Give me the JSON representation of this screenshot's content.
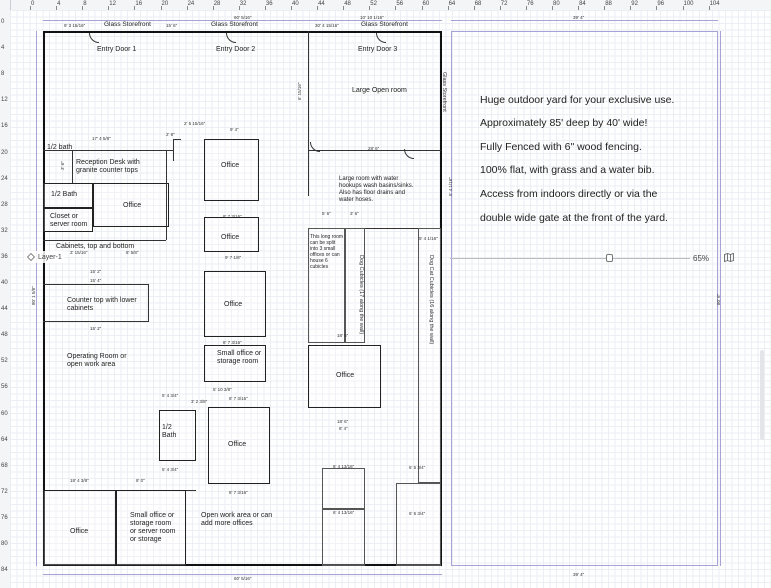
{
  "ruler": {
    "top": [
      "0",
      "4",
      "8",
      "12",
      "16",
      "20",
      "24",
      "28",
      "32",
      "36",
      "40",
      "44",
      "48",
      "52",
      "56",
      "60",
      "64",
      "68",
      "72",
      "76",
      "80",
      "84",
      "88",
      "92",
      "96",
      "100",
      "104"
    ],
    "left": [
      "0",
      "4",
      "8",
      "12",
      "16",
      "20",
      "24",
      "28",
      "32",
      "36",
      "40",
      "44",
      "48",
      "52",
      "56",
      "60",
      "64",
      "68",
      "72",
      "76",
      "80",
      "84"
    ]
  },
  "exterior": {
    "top_dim_outer": "60' 5/16\"",
    "top_dim_inner": "10' 10 1/16\"",
    "top_dim_right": "39' 4\"",
    "bottom_dim": "60' 5/16\"",
    "bottom_dim_right": "39' 4\"",
    "left_dim": "80' 1 5/8\"",
    "right_dim": "80' 6\"",
    "storefront_dims": [
      "9' 3 15/16\"",
      "15' 6\"",
      "30' 4 15/16\""
    ],
    "storefront_labels": [
      "Glass Storefront",
      "Glass Storefront",
      "Glass Storefront"
    ],
    "side_storefront": "Glass Storefront"
  },
  "rooms": {
    "entry_door_1": "Entry Door 1",
    "entry_door_2": "Entry Door 2",
    "entry_door_3": "Entry Door 3",
    "large_open_room": "Large Open room",
    "half_bath_top": "1/2 bath",
    "reception": "Reception Desk with granite counter tops",
    "half_bath_2": "1/2 Bath",
    "office_left": "Office",
    "closet": "Closet or server room",
    "cabinets": "Cabinets, top and bottom",
    "office_1": "Office",
    "office_2": "Office",
    "office_3": "Office",
    "small_office_storage": "Small office or storage room",
    "counter_top": "Counter top with lower cabinets",
    "operating_room": "Operating Room or open work area",
    "large_room_water": "Large room with water hookups wash basins/sinks. Also has floor drains and water hoses.",
    "long_room_note": "This long room can be split into 3 small offices or can house 6 cubicles",
    "cubicles_note_1": "Dog Cubicles (17 along the wall)",
    "cubicles_note_2": "Dog Cat Cubicles (16 along the wall)",
    "office_mid": "Office",
    "half_bath_3": "1/2 Bath",
    "office_lower": "Office",
    "open_work_area": "Open work area or can add more offices",
    "office_bottom": "Office",
    "small_office_bottom": "Small office or storage room or server room or storage"
  },
  "dims": {
    "d1": "17' 4 5/8\"",
    "d2": "2' 5 15/16\"",
    "d3": "9' 4\"",
    "d4": "2' 8\"",
    "d5": "28' 6\"",
    "d6": "6' 15/16\"",
    "d7": "8' 7 3/16\"",
    "d8": "9' 7 1/8\"",
    "d9": "3' 15/16\"",
    "d10": "8' 5/8\"",
    "d11": "15' 2\"",
    "d12": "15' 4\"",
    "d13": "15' 2\"",
    "d14": "8' 7 3/16\"",
    "d15": "5' 10 3/8\"",
    "d16": "5' 4 3/4\"",
    "d17": "8' 7 3/16\"",
    "d18": "3' 2 3/8\"",
    "d19": "5' 4 3/4\"",
    "d20": "18' 4 3/8\"",
    "d21": "8' 0\"",
    "d22": "8' 7 3/16\"",
    "d23": "18' 6\"",
    "d24": "6' 4 13/16\"",
    "d25": "6' 5 3/4\"",
    "d26": "6' 4 13/16\"",
    "d27": "6' 5 3/4\"",
    "d28": "5' 6\"",
    "d29": "3' 6\"",
    "d30": "5' 4 1/16\"",
    "d31": "18' 6\"",
    "d32": "8' 4\"",
    "d33": "9' 7 3/16\""
  },
  "yard_notes": [
    "Huge outdoor yard for your exclusive use.",
    "Approximately 85' deep by 40' wide!",
    "Fully Fenced with 6\" wood fencing.",
    "100% flat, with grass and a water bib.",
    "Access from indoors directly or via the",
    "double wide gate at the front of the yard."
  ],
  "ui": {
    "layer_name": "Layer-1",
    "zoom": "65%",
    "zoom_level": 0.65
  },
  "colors": {
    "wall": "#111111",
    "dimension": "#a8a3d6",
    "grid_minor": "#ebeef3",
    "grid_major": "#d6dbe3"
  }
}
